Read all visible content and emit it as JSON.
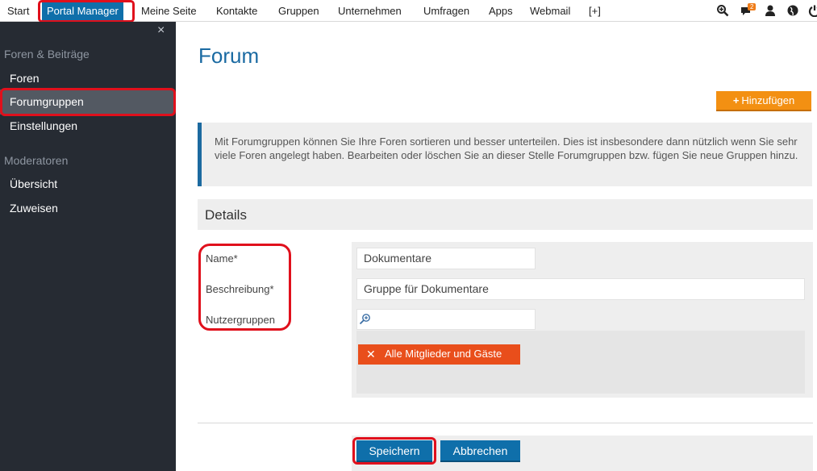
{
  "nav": {
    "items": [
      "Start",
      "Portal Manager",
      "Meine Seite",
      "Kontakte",
      "Gruppen",
      "Unternehmen",
      "Umfragen",
      "Apps",
      "Webmail",
      "[+]"
    ],
    "badge_count": "2",
    "icons": [
      "zoom-in-icon",
      "chat-icon",
      "user-icon",
      "globe-icon",
      "power-icon"
    ]
  },
  "sidebar": {
    "close_glyph": "×",
    "section1": "Foren & Beiträge",
    "items1": [
      "Foren",
      "Forumgruppen",
      "Einstellungen"
    ],
    "section2": "Moderatoren",
    "items2": [
      "Übersicht",
      "Zuweisen"
    ],
    "active_item": "Forumgruppen"
  },
  "main": {
    "title": "Forum",
    "add_label": "Hinzufügen",
    "info_text": "Mit Forumgruppen können Sie Ihre Foren sortieren und besser unterteilen. Dies ist insbesondere dann nützlich wenn Sie sehr viele Foren angelegt haben. Bearbeiten oder löschen Sie an dieser Stelle Forumgruppen bzw. fügen Sie neue Gruppen hinzu.",
    "details_title": "Details",
    "form": {
      "name_label": "Name*",
      "name_value": "Dokumentare",
      "desc_label": "Beschreibung*",
      "desc_value": "Gruppe für Dokumentare",
      "groups_label": "Nutzergruppen",
      "groups_search_value": "",
      "tags": [
        "Alle Mitglieder und Gäste"
      ]
    },
    "save_label": "Speichern",
    "cancel_label": "Abbrechen"
  },
  "colors": {
    "accent_blue": "#0f6faa",
    "accent_orange": "#f39012",
    "tag_orange": "#e94e1b",
    "sidebar_bg": "#262b33",
    "highlight_red": "#e0101c"
  }
}
